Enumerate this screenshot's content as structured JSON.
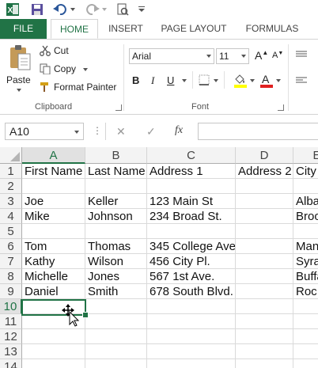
{
  "quick_access": {
    "app_icon": "excel-icon",
    "save_icon": "save-icon",
    "undo_icon": "undo-icon",
    "redo_icon": "redo-icon",
    "print_preview_icon": "print-preview-icon",
    "customize_icon": "customize-icon"
  },
  "tabs": [
    "FILE",
    "HOME",
    "INSERT",
    "PAGE LAYOUT",
    "FORMULAS"
  ],
  "active_tab": "HOME",
  "clipboard": {
    "paste_label": "Paste",
    "cut_label": "Cut",
    "copy_label": "Copy",
    "format_painter_label": "Format Painter",
    "group_label": "Clipboard"
  },
  "font": {
    "font_name": "Arial",
    "font_size": "11",
    "bold": "B",
    "italic": "I",
    "underline": "U",
    "grow": "A",
    "shrink": "A",
    "font_color_letter": "A",
    "group_label": "Font"
  },
  "formula_bar": {
    "name_box": "A10",
    "cancel_icon": "✕",
    "enter_icon": "✓",
    "fx_label": "fx",
    "formula_value": ""
  },
  "colors": {
    "accent": "#217346",
    "fill_highlight": "#ffff00",
    "font_red": "#e02020"
  },
  "sheet": {
    "columns": [
      "A",
      "B",
      "C",
      "D",
      "E"
    ],
    "rows": [
      [
        "1",
        "First Name",
        "Last Name",
        "Address 1",
        "Address 2",
        "City"
      ],
      [
        "2",
        "",
        "",
        "",
        "",
        ""
      ],
      [
        "3",
        "Joe",
        "Keller",
        "123 Main St",
        "",
        "Alba"
      ],
      [
        "4",
        "Mike",
        "Johnson",
        "234 Broad St.",
        "",
        "Broo"
      ],
      [
        "5",
        "",
        "",
        "",
        "",
        ""
      ],
      [
        "6",
        "Tom",
        "Thomas",
        "345 College Ave",
        "",
        "Man"
      ],
      [
        "7",
        "Kathy",
        "Wilson",
        "456 City Pl.",
        "",
        "Syra"
      ],
      [
        "8",
        "Michelle",
        "Jones",
        "567 1st Ave.",
        "",
        "Buffa"
      ],
      [
        "9",
        "Daniel",
        "Smith",
        "678 South Blvd.",
        "",
        "Roc"
      ],
      [
        "10",
        "",
        "",
        "",
        "",
        ""
      ],
      [
        "11",
        "",
        "",
        "",
        "",
        ""
      ],
      [
        "12",
        "",
        "",
        "",
        "",
        ""
      ],
      [
        "13",
        "",
        "",
        "",
        "",
        ""
      ],
      [
        "14",
        "",
        "",
        "",
        "",
        ""
      ]
    ],
    "selected_cell": "A10"
  }
}
